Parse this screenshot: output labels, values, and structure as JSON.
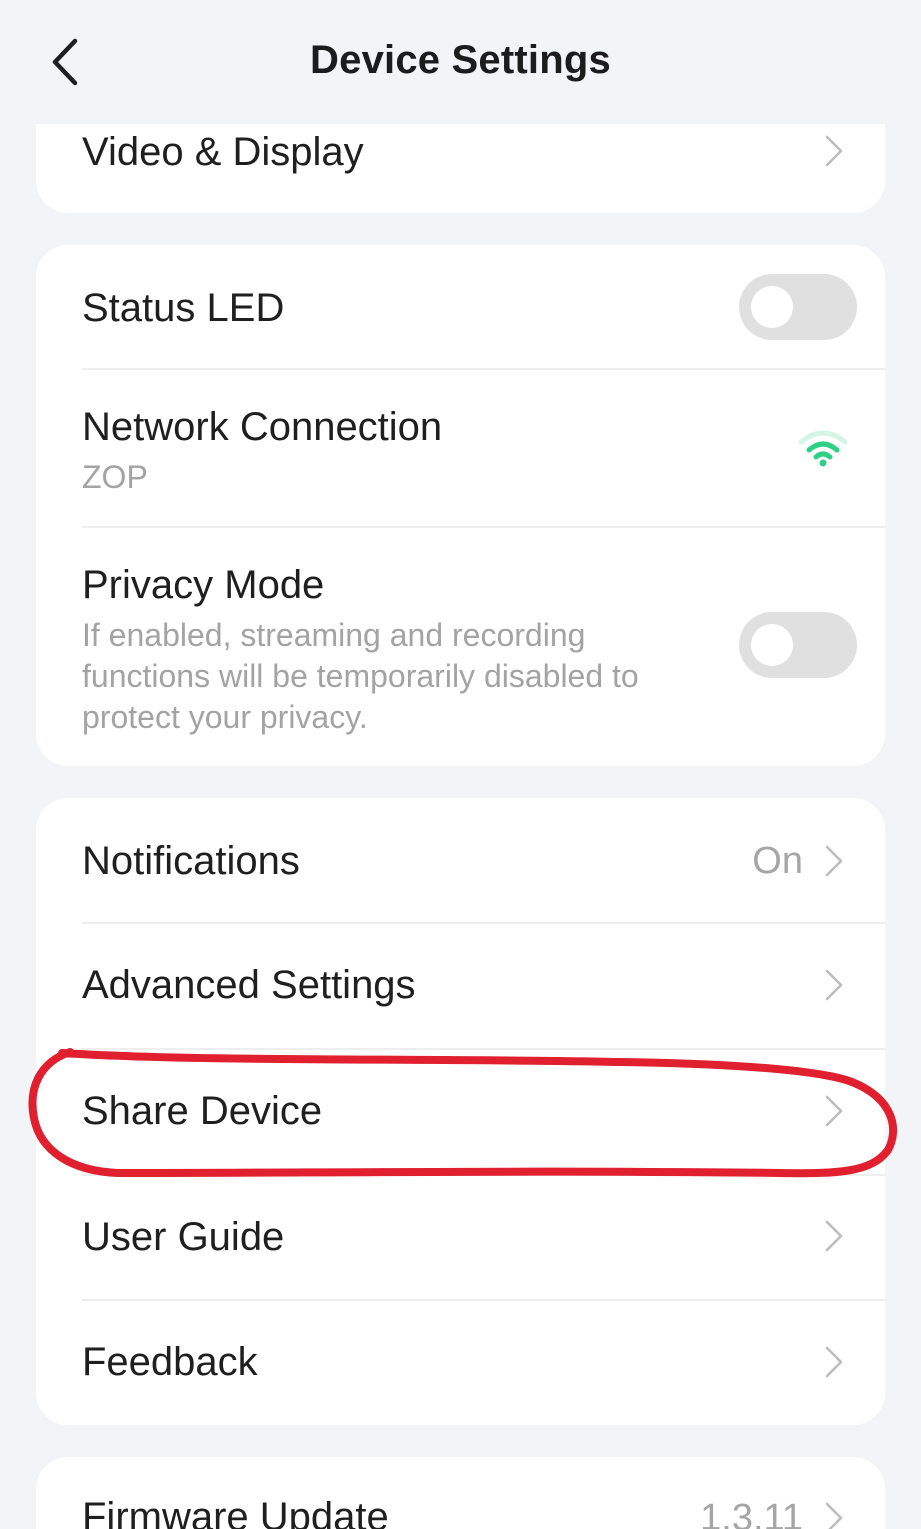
{
  "header": {
    "title": "Device Settings",
    "back_icon": "chevron-left-icon"
  },
  "sections": {
    "video_display": {
      "label": "Video & Display"
    },
    "status_led": {
      "label": "Status LED",
      "enabled": false
    },
    "network": {
      "label": "Network Connection",
      "ssid": "ZOP",
      "icon": "wifi-icon",
      "icon_color": "#2ecf86"
    },
    "privacy": {
      "label": "Privacy Mode",
      "description": "If enabled, streaming and recording functions will be temporarily disabled to protect your privacy.",
      "enabled": false
    },
    "notifications": {
      "label": "Notifications",
      "value": "On"
    },
    "advanced": {
      "label": "Advanced Settings"
    },
    "share": {
      "label": "Share Device"
    },
    "user_guide": {
      "label": "User Guide"
    },
    "feedback": {
      "label": "Feedback"
    },
    "firmware": {
      "label": "Firmware Update",
      "value": "1.3.11"
    }
  },
  "annotation": {
    "color": "#e0202e"
  }
}
